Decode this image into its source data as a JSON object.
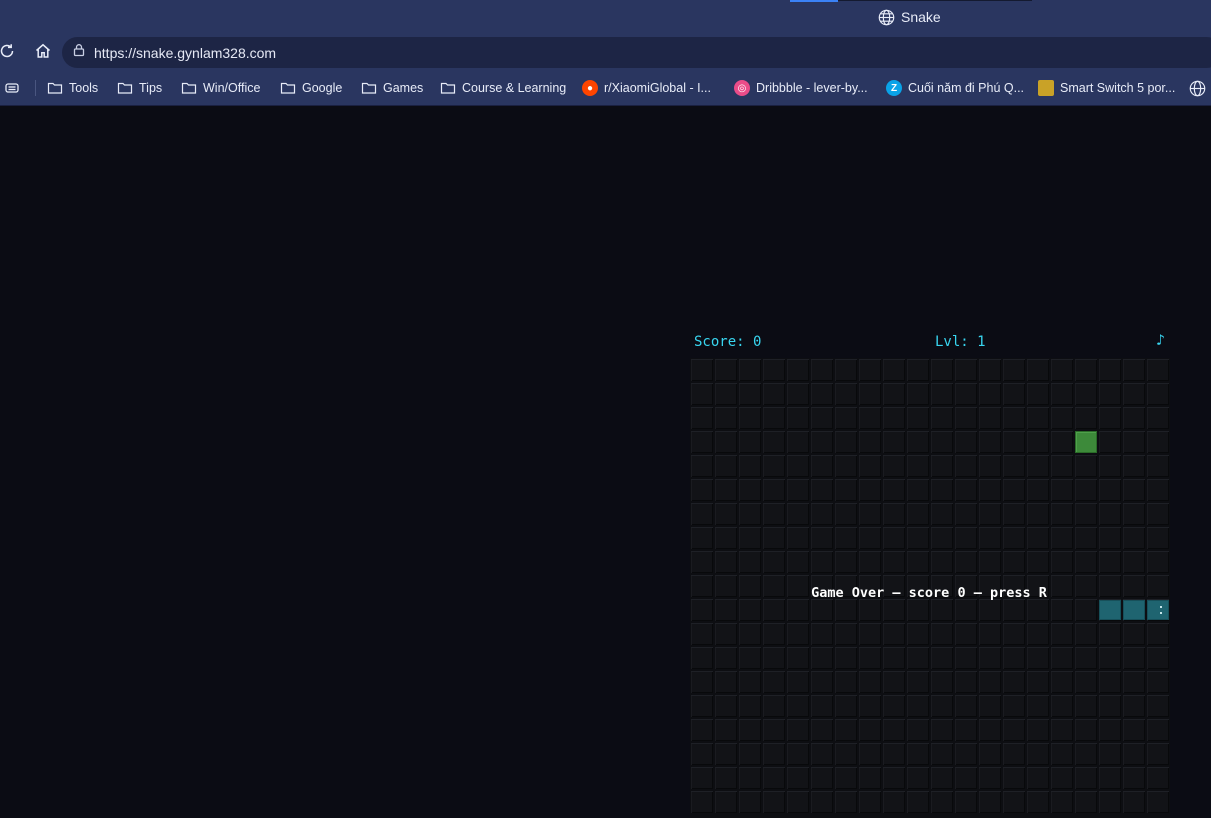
{
  "browser": {
    "tab_title": "Snake",
    "url": "https://snake.gynlam328.com",
    "bookmarks": [
      {
        "label": "Tools",
        "icon": "folder-icon"
      },
      {
        "label": "Tips",
        "icon": "folder-icon"
      },
      {
        "label": "Win/Office",
        "icon": "folder-icon"
      },
      {
        "label": "Google",
        "icon": "folder-icon"
      },
      {
        "label": "Games",
        "icon": "folder-icon"
      },
      {
        "label": "Course & Learning",
        "icon": "folder-icon"
      },
      {
        "label": "r/XiaomiGlobal - I...",
        "icon": "reddit-icon"
      },
      {
        "label": "Dribbble - lever-by...",
        "icon": "dribbble-icon"
      },
      {
        "label": "Cuối năm đi Phú Q...",
        "icon": "zalo-icon"
      },
      {
        "label": "Smart Switch 5 por...",
        "icon": "site-icon"
      }
    ]
  },
  "game": {
    "score_label": "Score: 0",
    "level_label": "Lvl: 1",
    "music_icon": "♪",
    "message": "Game Over — score 0 — press R",
    "grid_cols": 20,
    "grid_rows": 19,
    "food": {
      "col": 16,
      "row": 3
    },
    "snake": [
      {
        "col": 19,
        "row": 10,
        "head": true
      },
      {
        "col": 18,
        "row": 10
      },
      {
        "col": 17,
        "row": 10
      }
    ],
    "colors": {
      "hud": "#38d6f0",
      "food": "#3d8a3a",
      "snake": "#1f6470",
      "background": "#0b0c14"
    }
  }
}
